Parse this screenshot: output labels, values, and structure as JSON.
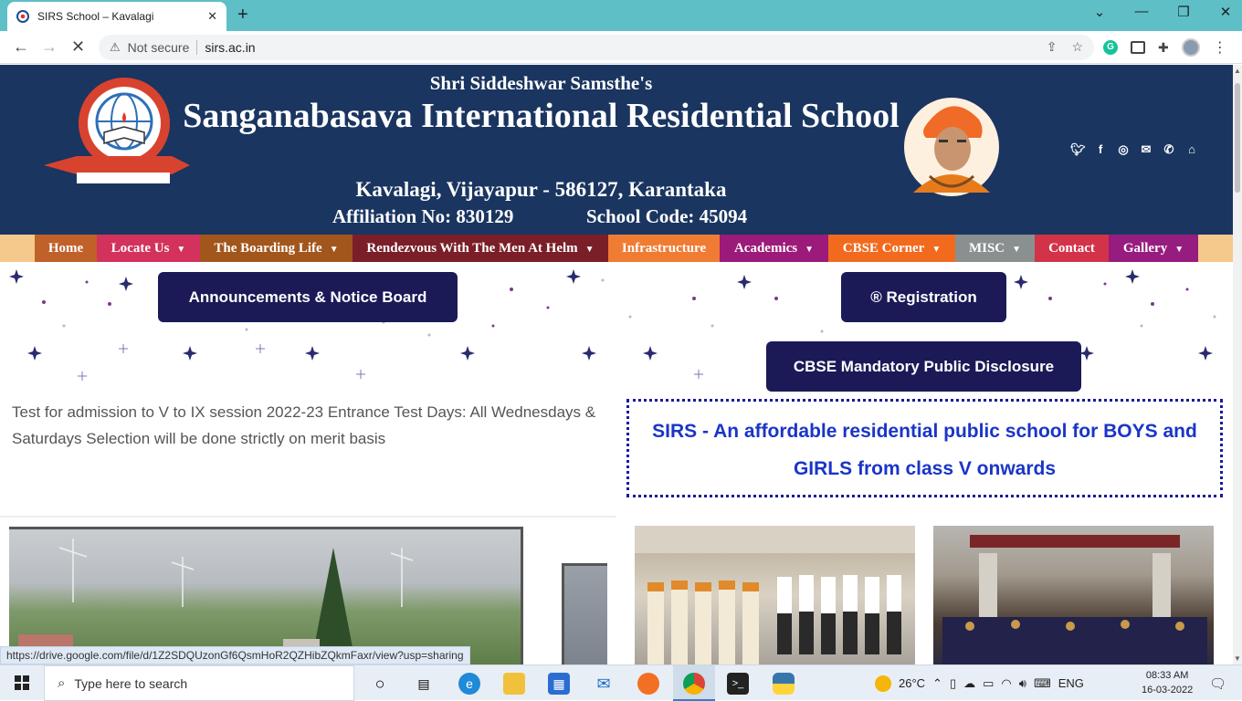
{
  "browser": {
    "tab_title": "SIRS School – Kavalagi",
    "new_tab": "+",
    "not_secure": "Not secure",
    "url": "sirs.ac.in",
    "window_controls": [
      "⌄",
      "—",
      "❐",
      "✕"
    ]
  },
  "header": {
    "samsthe": "Shri Siddeshwar Samsthe's",
    "school_name": "Sanganabasava International Residential School",
    "address": "Kavalagi, Vijayapur - 586127, Karantaka",
    "affiliation": "Affiliation No: 830129",
    "school_code": "School Code: 45094",
    "socials": [
      "twitter-icon",
      "facebook-icon",
      "instagram-icon",
      "mail-icon",
      "phone-icon",
      "bank-icon"
    ]
  },
  "menu": [
    {
      "label": "Home",
      "color": "#c0612a",
      "caret": false
    },
    {
      "label": "Locate Us",
      "color": "#d2325b",
      "caret": true
    },
    {
      "label": "The Boarding Life",
      "color": "#a2561b",
      "caret": true
    },
    {
      "label": "Rendezvous With The Men At Helm",
      "color": "#7a1e27",
      "caret": true
    },
    {
      "label": "Infrastructure",
      "color": "#f07b33",
      "caret": false
    },
    {
      "label": "Academics",
      "color": "#9c1a7a",
      "caret": true
    },
    {
      "label": "CBSE Corner",
      "color": "#f16a1e",
      "caret": true
    },
    {
      "label": "MISC",
      "color": "#8a8f8f",
      "caret": true
    },
    {
      "label": "Contact",
      "color": "#d23349",
      "caret": false
    },
    {
      "label": "Gallery",
      "color": "#971c7f",
      "caret": true
    }
  ],
  "buttons": {
    "announcements": "Announcements & Notice Board",
    "registration": "® Registration",
    "cbse_disclosure": "CBSE Mandatory Public Disclosure"
  },
  "notice": "Test for admission to V to IX session 2022-23 Entrance Test Days: All Wednesdays & Saturdays Selection will be done strictly on merit basis",
  "promo": "SIRS - An affordable residential public school for BOYS and GIRLS from class V onwards",
  "status_url": "https://drive.google.com/file/d/1Z2SDQUzonGf6QsmHoR2QZHibZQkmFaxr/view?usp=sharing",
  "taskbar": {
    "search_placeholder": "Type here to search",
    "temperature": "26°C",
    "language": "ENG",
    "time": "08:33 AM",
    "date": "16-03-2022"
  }
}
